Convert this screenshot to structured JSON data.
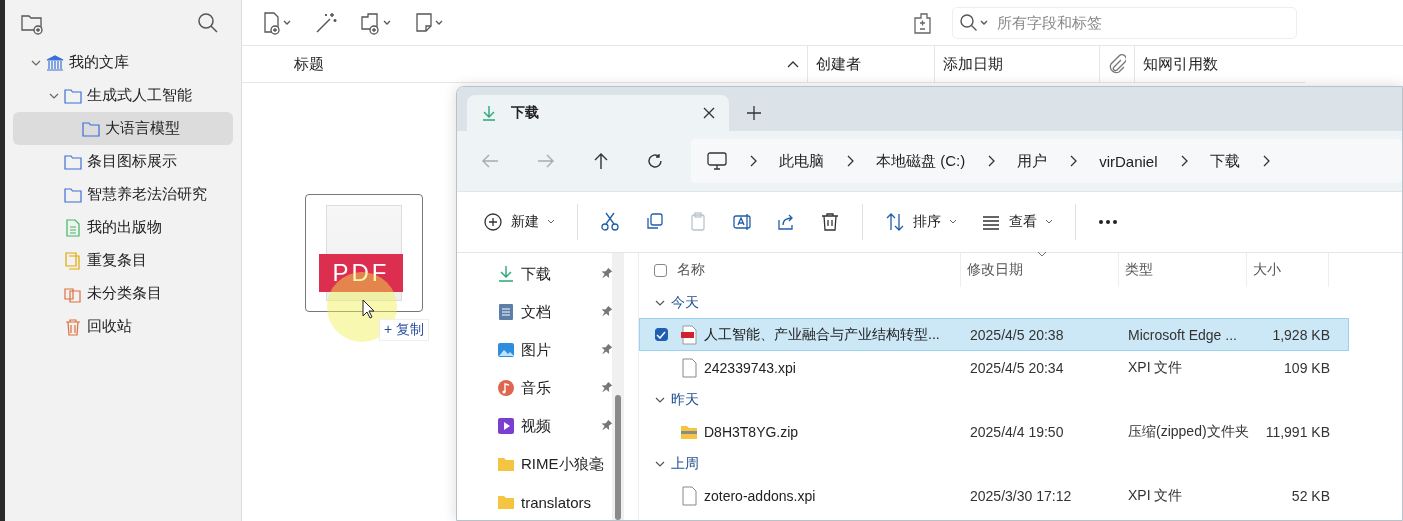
{
  "zotero": {
    "toolbar": {
      "search": {
        "placeholder": "所有字段和标签"
      }
    },
    "sidebar": {
      "items": [
        {
          "kind": "library",
          "label": "我的文库",
          "expanded": true,
          "selected": false,
          "children": [
            {
              "kind": "folder",
              "label": "生成式人工智能",
              "expanded": true,
              "selected": false,
              "children": [
                {
                  "kind": "folder",
                  "label": "大语言模型",
                  "selected": true
                }
              ]
            },
            {
              "kind": "folder",
              "label": "条目图标展示",
              "selected": false
            },
            {
              "kind": "folder",
              "label": "智慧养老法治研究",
              "selected": false
            },
            {
              "kind": "publications",
              "label": "我的出版物",
              "selected": false
            },
            {
              "kind": "duplicates",
              "label": "重复条目",
              "selected": false
            },
            {
              "kind": "unfiled",
              "label": "未分类条目",
              "selected": false
            },
            {
              "kind": "trash",
              "label": "回收站",
              "selected": false
            }
          ]
        }
      ]
    },
    "columns": [
      {
        "kind": "text",
        "label": "标题",
        "sorted": true,
        "descending": false
      },
      {
        "kind": "text",
        "label": "创建者"
      },
      {
        "kind": "text",
        "label": "添加日期"
      },
      {
        "kind": "attachment"
      },
      {
        "kind": "text",
        "label": "知网引用数"
      }
    ]
  },
  "drag_preview": {
    "badge": "PDF",
    "action": "+ 复制"
  },
  "explorer": {
    "tab": {
      "title": "下载",
      "selected": true
    },
    "breadcrumb": [
      "此电脑",
      "本地磁盘 (C:)",
      "用户",
      "virDaniel",
      "下载"
    ],
    "commands": [
      {
        "kind": "new",
        "label": "新建",
        "disabled": false
      },
      {
        "kind": "cut",
        "disabled": false
      },
      {
        "kind": "copy",
        "disabled": false
      },
      {
        "kind": "paste",
        "disabled": true
      },
      {
        "kind": "rename",
        "disabled": false
      },
      {
        "kind": "share",
        "disabled": false
      },
      {
        "kind": "delete",
        "disabled": false
      },
      {
        "kind": "sort",
        "label": "排序",
        "disabled": false
      },
      {
        "kind": "view",
        "label": "查看",
        "disabled": false
      },
      {
        "kind": "more",
        "disabled": false
      }
    ],
    "nav": [
      {
        "kind": "download",
        "label": "下载",
        "pinned": true
      },
      {
        "kind": "document",
        "label": "文档",
        "pinned": true
      },
      {
        "kind": "picture",
        "label": "图片",
        "pinned": true
      },
      {
        "kind": "music",
        "label": "音乐",
        "pinned": true
      },
      {
        "kind": "video",
        "label": "视频",
        "pinned": true
      },
      {
        "kind": "folder",
        "label": "RIME小狼毫",
        "pinned": false
      },
      {
        "kind": "folder",
        "label": "translators",
        "pinned": false
      }
    ],
    "select_all": {
      "checked": false
    },
    "columns": [
      {
        "label": "名称"
      },
      {
        "label": "修改日期",
        "sorted": true,
        "descending": true
      },
      {
        "label": "类型"
      },
      {
        "label": "大小"
      }
    ],
    "groups": [
      {
        "label": "今天",
        "expanded": true,
        "files": [
          {
            "kind": "pdf",
            "name": "人工智能、产业融合与产业结构转型...",
            "date": "2025/4/5 20:38",
            "type": "Microsoft Edge ...",
            "size": "1,928 KB",
            "selected": true
          },
          {
            "kind": "file",
            "name": "242339743.xpi",
            "date": "2025/4/5 20:34",
            "type": "XPI 文件",
            "size": "109 KB",
            "selected": false
          }
        ]
      },
      {
        "label": "昨天",
        "expanded": true,
        "files": [
          {
            "kind": "zip",
            "name": "D8H3T8YG.zip",
            "date": "2025/4/4 19:50",
            "type": "压缩(zipped)文件夹",
            "size": "11,991 KB",
            "selected": false
          }
        ]
      },
      {
        "label": "上周",
        "expanded": true,
        "files": [
          {
            "kind": "file",
            "name": "zotero-addons.xpi",
            "date": "2025/3/30 17:12",
            "type": "XPI 文件",
            "size": "52 KB",
            "selected": false
          }
        ]
      }
    ]
  }
}
